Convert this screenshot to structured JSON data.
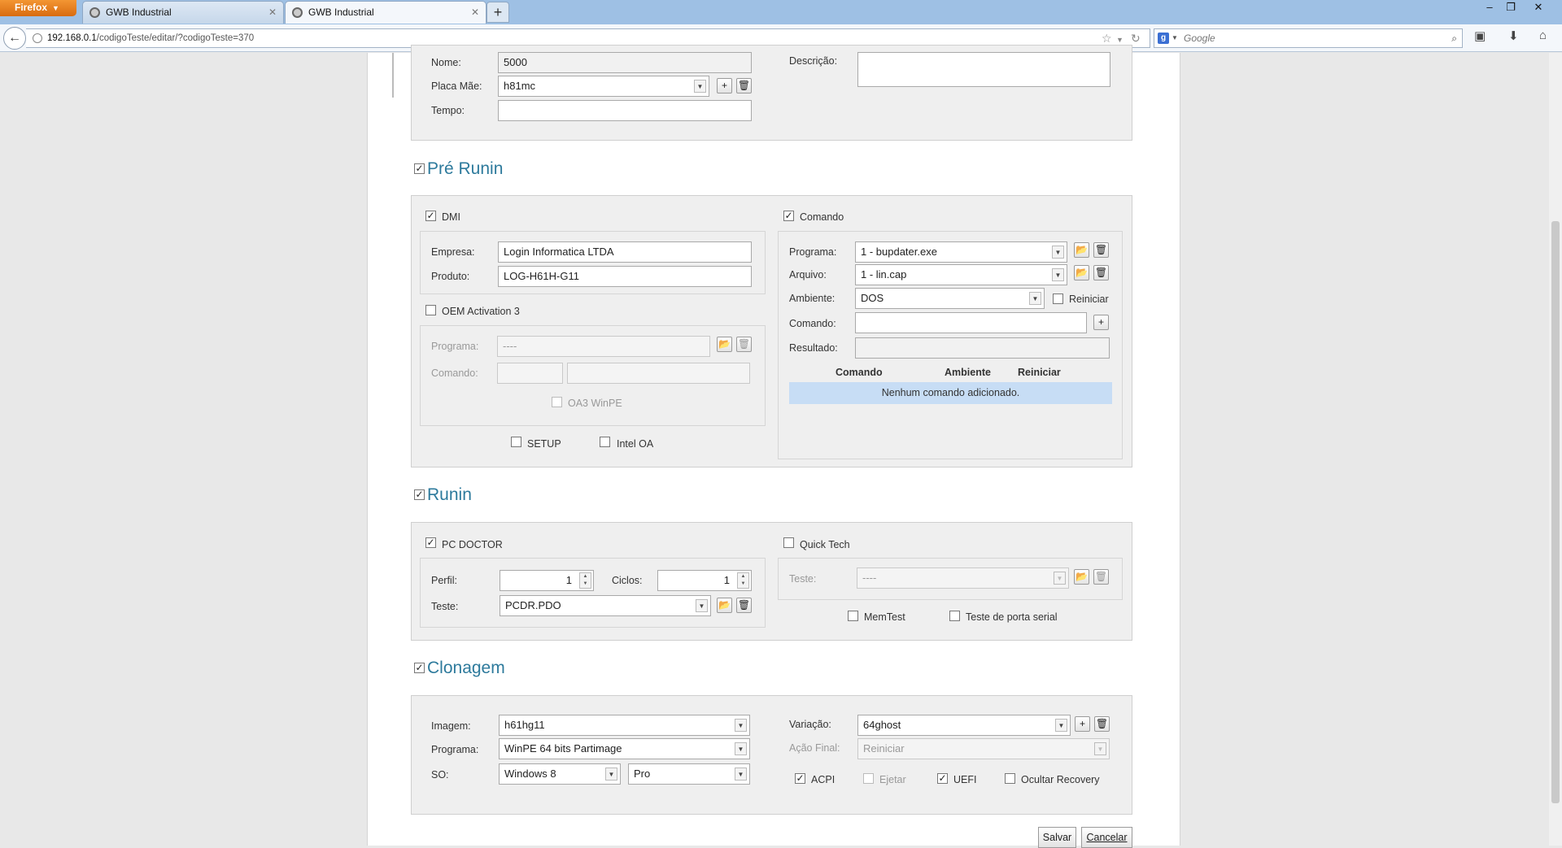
{
  "browser": {
    "menu_label": "Firefox",
    "tabs": [
      {
        "title": "GWB Industrial"
      },
      {
        "title": "GWB Industrial"
      }
    ],
    "url_host": "192.168.0.1",
    "url_path": "/codigoTeste/editar/?codigoTeste=370",
    "search_placeholder": "Google"
  },
  "general": {
    "nome_label": "Nome:",
    "nome_value": "5000",
    "placa_label": "Placa Mãe:",
    "placa_value": "h81mc",
    "tempo_label": "Tempo:",
    "tempo_value": "",
    "descricao_label": "Descrição:"
  },
  "pre_runin": {
    "title": "Pré Runin",
    "checked": true,
    "dmi": {
      "label": "DMI",
      "checked": true,
      "empresa_label": "Empresa:",
      "empresa_value": "Login Informatica LTDA",
      "produto_label": "Produto:",
      "produto_value": "LOG-H61H-G11"
    },
    "oem": {
      "label": "OEM Activation 3",
      "checked": false,
      "programa_label": "Programa:",
      "programa_value": "----",
      "comando_label": "Comando:",
      "oa3_label": "OA3 WinPE"
    },
    "setup_label": "SETUP",
    "intel_oa_label": "Intel OA",
    "comando": {
      "label": "Comando",
      "checked": true,
      "programa_label": "Programa:",
      "programa_value": "1 - bupdater.exe",
      "arquivo_label": "Arquivo:",
      "arquivo_value": "1 - lin.cap",
      "ambiente_label": "Ambiente:",
      "ambiente_value": "DOS",
      "reiniciar_label": "Reiniciar",
      "comando_label": "Comando:",
      "resultado_label": "Resultado:",
      "table_headers": [
        "Comando",
        "Ambiente",
        "Reiniciar"
      ],
      "empty_message": "Nenhum comando adicionado."
    }
  },
  "runin": {
    "title": "Runin",
    "checked": true,
    "pc_doctor": {
      "label": "PC DOCTOR",
      "checked": true,
      "perfil_label": "Perfil:",
      "perfil_value": "1",
      "ciclos_label": "Ciclos:",
      "ciclos_value": "1",
      "teste_label": "Teste:",
      "teste_value": "PCDR.PDO"
    },
    "quick_tech": {
      "label": "Quick Tech",
      "checked": false,
      "teste_label": "Teste:",
      "teste_value": "----"
    },
    "memtest_label": "MemTest",
    "serial_label": "Teste de porta serial"
  },
  "clonagem": {
    "title": "Clonagem",
    "checked": true,
    "imagem_label": "Imagem:",
    "imagem_value": "h61hg11",
    "programa_label": "Programa:",
    "programa_value": "WinPE 64 bits Partimage",
    "so_label": "SO:",
    "so_value": "Windows 8",
    "edicao_value": "Pro",
    "variacao_label": "Variação:",
    "variacao_value": "64ghost",
    "acao_label": "Ação Final:",
    "acao_value": "Reiniciar",
    "acpi_label": "ACPI",
    "ejetar_label": "Ejetar",
    "uefi_label": "UEFI",
    "ocultar_label": "Ocultar Recovery"
  },
  "actions": {
    "salvar": "Salvar",
    "cancelar": "Cancelar"
  }
}
